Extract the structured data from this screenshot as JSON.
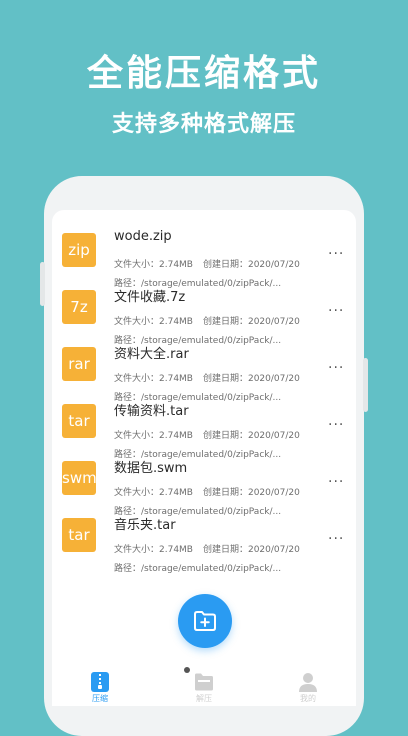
{
  "promo": {
    "headline": "全能压缩格式",
    "subline": "支持多种格式解压"
  },
  "files": [
    {
      "badge": "zip",
      "name": "wode.zip",
      "size": "文件大小：2.74MB",
      "date": "创建日期：2020/07/20",
      "path": "路径：/storage/emulated/0/zipPack/..."
    },
    {
      "badge": "7z",
      "name": "文件收藏.7z",
      "size": "文件大小：2.74MB",
      "date": "创建日期：2020/07/20",
      "path": "路径：/storage/emulated/0/zipPack/..."
    },
    {
      "badge": "rar",
      "name": "资料大全.rar",
      "size": "文件大小：2.74MB",
      "date": "创建日期：2020/07/20",
      "path": "路径：/storage/emulated/0/zipPack/..."
    },
    {
      "badge": "tar",
      "name": "传输资料.tar",
      "size": "文件大小：2.74MB",
      "date": "创建日期：2020/07/20",
      "path": "路径：/storage/emulated/0/zipPack/..."
    },
    {
      "badge": "swm",
      "name": "数据包.swm",
      "size": "文件大小：2.74MB",
      "date": "创建日期：2020/07/20",
      "path": "路径：/storage/emulated/0/zipPack/..."
    },
    {
      "badge": "tar",
      "name": "音乐夹.tar",
      "size": "文件大小：2.74MB",
      "date": "创建日期：2020/07/20",
      "path": "路径：/storage/emulated/0/zipPack/..."
    }
  ],
  "more_label": "···",
  "tabs": [
    {
      "label": "压缩",
      "icon": "zip-file-icon",
      "active": true
    },
    {
      "label": "解压",
      "icon": "folder-icon",
      "active": false
    },
    {
      "label": "我的",
      "icon": "user-icon",
      "active": false
    }
  ],
  "fab_icon": "add-folder-icon",
  "colors": {
    "background": "#62c0c6",
    "badge": "#f6b137",
    "accent": "#2a9bf2",
    "tab_inactive": "#cfcfcf"
  }
}
